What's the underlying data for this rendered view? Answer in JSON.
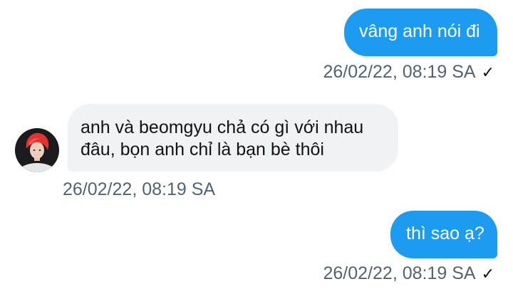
{
  "messages": [
    {
      "direction": "sent",
      "text": "vâng anh nói đi",
      "timestamp": "26/02/22, 08:19 SA",
      "status_icon": "check-icon"
    },
    {
      "direction": "received",
      "lines": [
        "anh và beomgyu chả có gì với nhau",
        "đâu, bọn anh chỉ là bạn bè thôi"
      ],
      "timestamp": "26/02/22, 08:19 SA",
      "avatar_icon": "avatar"
    },
    {
      "direction": "sent",
      "text": "thì sao ạ?",
      "timestamp": "26/02/22, 08:19 SA",
      "status_icon": "check-icon"
    }
  ],
  "colors": {
    "sent_bubble": "#1d9bf0",
    "received_bubble": "#eff3f4",
    "timestamp": "#536471"
  },
  "check_glyph": "✓"
}
